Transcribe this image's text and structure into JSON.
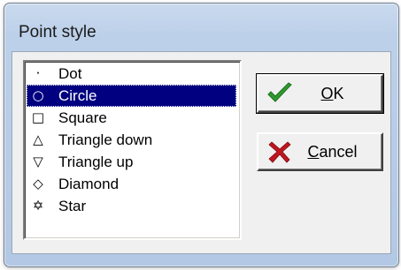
{
  "window": {
    "title": "Point style"
  },
  "list": {
    "items": [
      {
        "glyph": "·",
        "label": "Dot",
        "icon": "dot-glyph"
      },
      {
        "glyph": "○",
        "label": "Circle",
        "icon": "circle-glyph"
      },
      {
        "glyph": "□",
        "label": "Square",
        "icon": "square-glyph"
      },
      {
        "glyph": "△",
        "label": "Triangle down",
        "icon": "triangle-outline-glyph"
      },
      {
        "glyph": "▽",
        "label": "Triangle up",
        "icon": "triangle-down-outline-glyph"
      },
      {
        "glyph": "◇",
        "label": "Diamond",
        "icon": "diamond-glyph"
      },
      {
        "glyph": "✡",
        "label": "Star",
        "icon": "star-of-david-glyph"
      }
    ],
    "selected_index": 1
  },
  "buttons": {
    "ok": {
      "accel": "O",
      "rest": "K",
      "icon": "check-icon",
      "icon_color": "#2e9a2e"
    },
    "cancel": {
      "accel": "C",
      "rest": "ancel",
      "icon": "x-icon",
      "icon_color": "#c0161e"
    }
  }
}
